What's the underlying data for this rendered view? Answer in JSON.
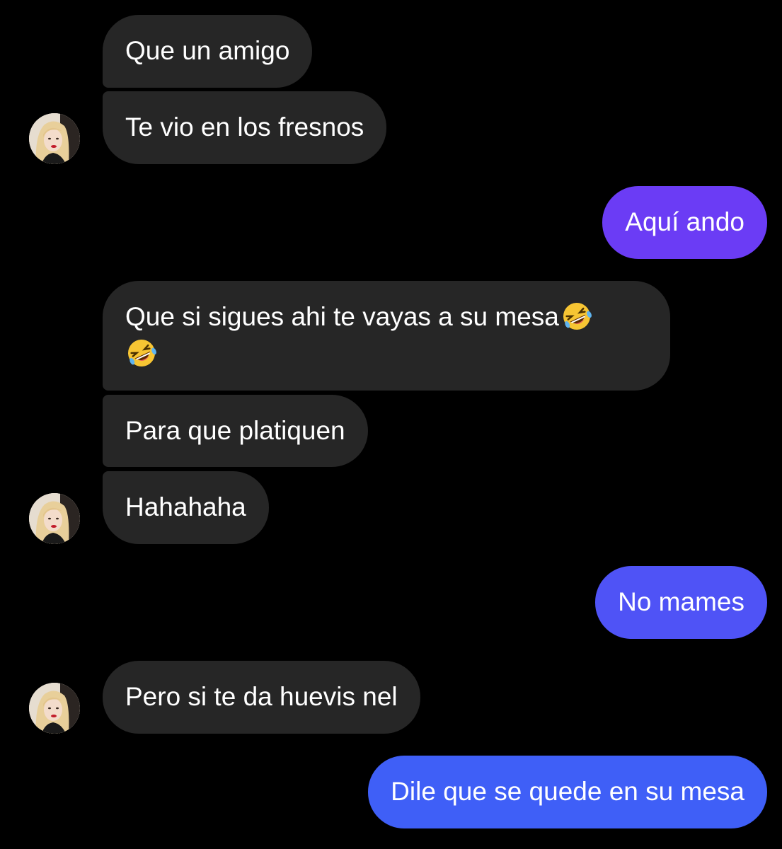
{
  "colors": {
    "background": "#000000",
    "incoming_bubble": "#262626",
    "outgoing_purple": "#6b3cf5",
    "outgoing_blue": "#4a5cf7",
    "text": "#ffffff"
  },
  "messages": [
    {
      "sender": "them",
      "text": "Que un amigo"
    },
    {
      "sender": "them",
      "text": "Te vio en los fresnos"
    },
    {
      "sender": "me",
      "text": "Aquí ando"
    },
    {
      "sender": "them",
      "text": "Que si sigues ahi te vayas a su mesa",
      "emoji": "rolling-on-floor-laughing-icon"
    },
    {
      "sender": "them",
      "text": "Para que platiquen"
    },
    {
      "sender": "them",
      "text": "Hahahaha"
    },
    {
      "sender": "me",
      "text": "No mames"
    },
    {
      "sender": "them",
      "text": "Pero si te da huevis nel"
    },
    {
      "sender": "me",
      "text": "Dile que se quede en su mesa"
    }
  ]
}
